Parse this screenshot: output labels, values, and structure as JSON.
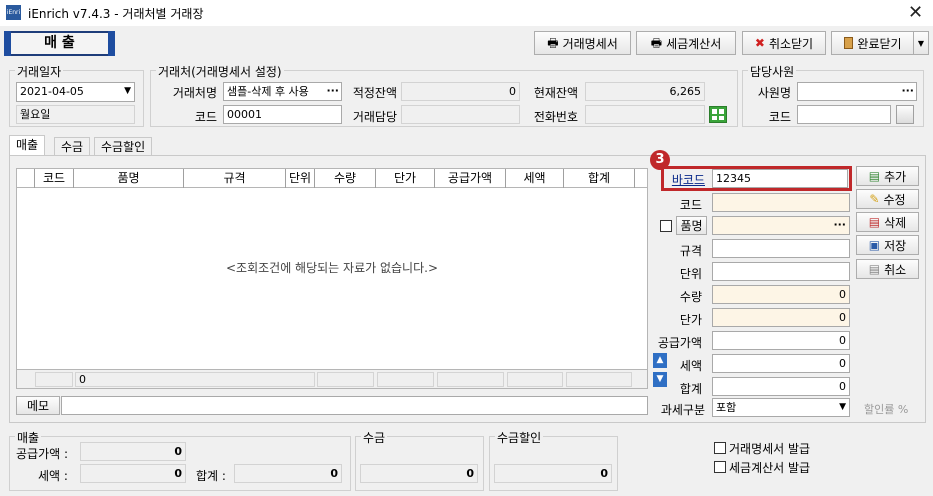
{
  "window": {
    "app_name": "iEnrich v7.4.3 - 거래처별 거래장",
    "icon_text": "iEnri"
  },
  "main_tab": {
    "label": "매 출"
  },
  "toolbar": {
    "statement_label": "거래명세서",
    "tax_invoice_label": "세금계산서",
    "cancel_close_label": "취소닫기",
    "complete_close_label": "완료닫기"
  },
  "trade_date": {
    "group_label": "거래일자",
    "date": "2021-04-05",
    "weekday": "월요일"
  },
  "client": {
    "group_label": "거래처(거래명세서 설정)",
    "name_label": "거래처명",
    "name_value": "샘플-삭제 후 사용",
    "code_label": "코드",
    "code_value": "00001",
    "balance_label": "적정잔액",
    "balance_value": "0",
    "current_balance_label": "현재잔액",
    "current_balance_value": "6,265",
    "manager_label": "거래담당",
    "manager_value": "",
    "phone_label": "전화번호",
    "phone_value": ""
  },
  "staff": {
    "group_label": "담당사원",
    "name_label": "사원명",
    "name_value": "",
    "code_label": "코드",
    "code_value": ""
  },
  "subtabs": [
    "매출",
    "수금",
    "수금할인"
  ],
  "grid": {
    "columns": [
      "코드",
      "품명",
      "규격",
      "단위",
      "수량",
      "단가",
      "공급가액",
      "세액",
      "합계"
    ],
    "empty_message": "<조회조건에 해당되는 자료가 없습니다.>",
    "footer_value": "0"
  },
  "form": {
    "badge": "3",
    "barcode_label": "바코드",
    "barcode_value": "12345",
    "code_label": "코드",
    "code_value": "",
    "item_label": "품명",
    "item_value": "",
    "spec_label": "규격",
    "spec_value": "",
    "unit_label": "단위",
    "unit_value": "",
    "qty_label": "수량",
    "qty_value": "0",
    "price_label": "단가",
    "price_value": "0",
    "supply_label": "공급가액",
    "supply_value": "0",
    "tax_label": "세액",
    "tax_value": "0",
    "total_label": "합계",
    "total_value": "0",
    "tax_type_label": "과세구분",
    "tax_type_value": "포함",
    "discount_rate_label": "할인률 %"
  },
  "side_buttons": {
    "add": "추가",
    "edit": "수정",
    "delete": "삭제",
    "save": "저장",
    "cancel": "취소"
  },
  "memo": {
    "label": "메모",
    "value": ""
  },
  "summary": {
    "sales": {
      "group_label": "매출",
      "supply_label": "공급가액 :",
      "supply_value": "0",
      "tax_label": "세액 :",
      "tax_value": "0",
      "total_label": "합계 :",
      "total_value": "0"
    },
    "collection": {
      "group_label": "수금",
      "value": "0"
    },
    "collection_discount": {
      "group_label": "수금할인",
      "value": "0"
    }
  },
  "checks": {
    "statement_issue": "거래명세서 발급",
    "tax_invoice_issue": "세금계산서 발급"
  },
  "colors": {
    "accent_blue": "#1e4da0",
    "badge_red": "#c0282a",
    "cream": "#fdf5e6"
  }
}
